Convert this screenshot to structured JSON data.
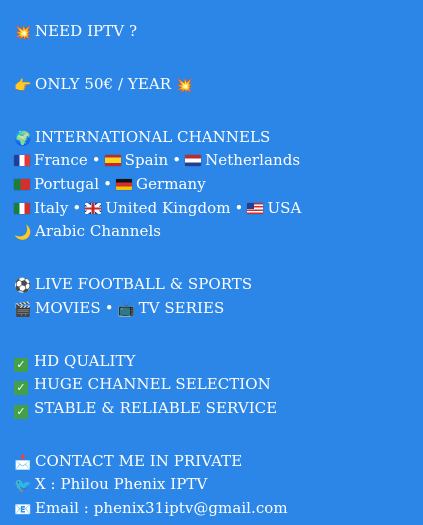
{
  "post": {
    "headline": {
      "icon": "💥",
      "text": "NEED IPTV ?"
    },
    "price": {
      "icon": "👉",
      "text": "ONLY 50€ / YEAR",
      "trail_icon": "💥"
    },
    "channels_title": {
      "icon": "🌍",
      "text": "INTERNATIONAL CHANNELS"
    },
    "countries_row1": [
      "France",
      "Spain",
      "Netherlands"
    ],
    "countries_row2": [
      "Portugal",
      "Germany"
    ],
    "countries_row3": [
      "Italy",
      "United Kingdom",
      "USA"
    ],
    "arabic": {
      "icon": "🌙",
      "text": "Arabic Channels"
    },
    "sports": {
      "icon": "⚽",
      "text": "LIVE FOOTBALL & SPORTS"
    },
    "movies": {
      "icon": "🎬",
      "text": "MOVIES",
      "tv_icon": "📺",
      "tv_text": "TV SERIES"
    },
    "features": [
      "HD QUALITY",
      "HUGE CHANNEL SELECTION",
      "STABLE & RELIABLE SERVICE"
    ],
    "contact": {
      "icon": "📩",
      "text": "CONTACT ME IN PRIVATE"
    },
    "x_handle": {
      "icon": "🐦",
      "text": "X : Philou Phenix IPTV"
    },
    "email": {
      "icon": "📧",
      "text": "Email : phenix31iptv@gmail.com"
    },
    "separator": "•",
    "check_icon": "✓",
    "colors": {
      "background": "#2b86e8",
      "text": "#ffffff",
      "check": "#43a047"
    }
  }
}
